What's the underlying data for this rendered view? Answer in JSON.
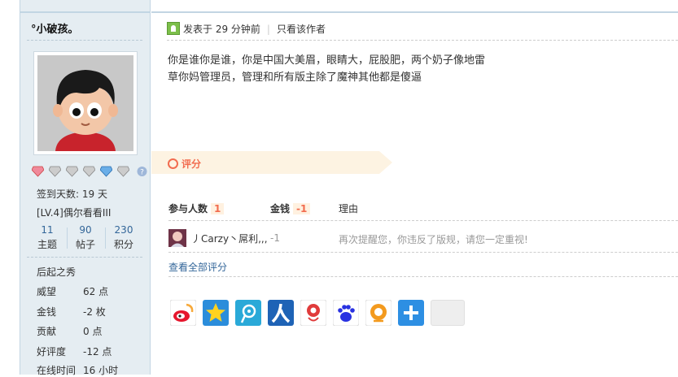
{
  "author": {
    "name": "°小破孩｡",
    "signin": "签到天数: 19 天",
    "level": "[LV.4]偶尔看看III",
    "stats": [
      {
        "num": "11",
        "label": "主题"
      },
      {
        "num": "90",
        "label": "帖子"
      },
      {
        "num": "230",
        "label": "积分"
      }
    ],
    "rank": "后起之秀",
    "profile": [
      {
        "key": "威望",
        "value": "62 点"
      },
      {
        "key": "金钱",
        "value": "-2 枚"
      },
      {
        "key": "贡献",
        "value": "0 点"
      },
      {
        "key": "好评度",
        "value": "-12 点"
      },
      {
        "key": "在线时间",
        "value": "16 小时"
      }
    ]
  },
  "post": {
    "posted": "发表于 29 分钟前",
    "author_only": "只看该作者",
    "lines": [
      "你是谁你是谁，你是中国大美眉，眼睛大，屁股肥，两个奶子像地雷",
      "草你妈管理员，管理和所有版主除了魔神其他都是傻逼"
    ]
  },
  "rating": {
    "title": "评分",
    "participants_label": "参与人数",
    "participants_count": "1",
    "money_label": "金钱",
    "money_total": "-1",
    "reason_label": "理由",
    "rows": [
      {
        "name": "丿Carzy丶屌利,,,",
        "amount": "-1",
        "reason": "再次提醒您，你违反了版规，请您一定重视!"
      }
    ],
    "view_all": "查看全部评分"
  },
  "share_icons": [
    "weibo-icon",
    "qzone-icon",
    "tencent-weibo-icon",
    "renren-icon",
    "kaixin-icon",
    "baidu-icon",
    "douban-icon",
    "more-share-icon",
    "blank-share-icon"
  ],
  "colors": {
    "sidebar_bg": "#e5edf2",
    "link": "#336699",
    "accent": "#f26c4f"
  }
}
